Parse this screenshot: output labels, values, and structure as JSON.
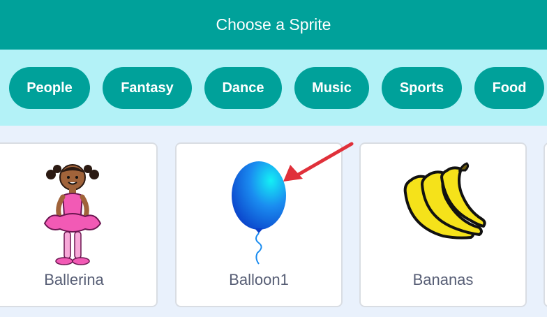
{
  "dialog": {
    "title": "Choose a Sprite"
  },
  "categories": [
    "People",
    "Fantasy",
    "Dance",
    "Music",
    "Sports",
    "Food"
  ],
  "sprites": [
    {
      "name": "Ballerina",
      "icon": "ballerina-icon"
    },
    {
      "name": "Balloon1",
      "icon": "balloon-icon"
    },
    {
      "name": "Bananas",
      "icon": "bananas-icon"
    }
  ],
  "colors": {
    "header": "#00a19a",
    "filter_bar": "#b3f2f7",
    "pill": "#00a19a",
    "grid_background": "#e9f1fc",
    "annotation_arrow": "#e0303a"
  }
}
